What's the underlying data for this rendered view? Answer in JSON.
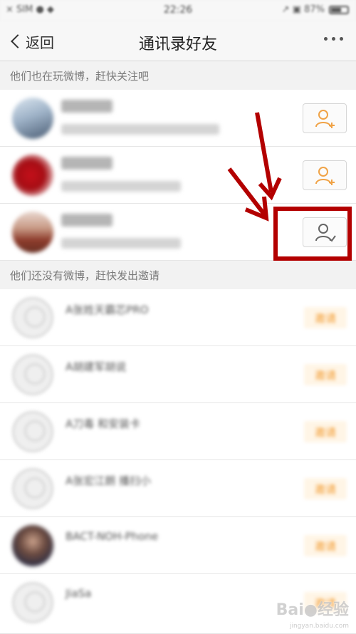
{
  "status_bar": {
    "left": "× SIM ● ◆",
    "time": "22:26",
    "right": "↗ ▣ 87%"
  },
  "nav": {
    "back_label": "返回",
    "title": "通讯录好友",
    "more_icon": "ellipsis-icon"
  },
  "sections": {
    "on_weibo_header": "他们也在玩微博，赶快关注吧",
    "not_on_weibo_header": "他们还没有微博，赶快发出邀请"
  },
  "invite_label": "邀请",
  "watermark": {
    "main": "Bai●经验",
    "sub": "jingyan.baidu.com"
  },
  "colors": {
    "accent_orange": "#f29a2e",
    "annotation_red": "#b30000",
    "follow_icon_orange": "#f0a347",
    "followed_icon_gray": "#666666"
  },
  "contacts_on_weibo": [
    {
      "status": "follow",
      "icon": "add-user-icon"
    },
    {
      "status": "follow",
      "icon": "add-user-icon"
    },
    {
      "status": "followed",
      "icon": "user-check-icon"
    }
  ],
  "contacts_invite": [
    {
      "name": "A张姓天霸芯PRO",
      "avatar": "placeholder"
    },
    {
      "name": "A胡建军胡说",
      "avatar": "placeholder"
    },
    {
      "name": "A刀毒 和安装卡",
      "avatar": "placeholder"
    },
    {
      "name": "A张宏江朗 播扫小",
      "avatar": "placeholder"
    },
    {
      "name": "BACT-NOH-Phone",
      "avatar": "photo"
    },
    {
      "name": "JiaSa",
      "avatar": "placeholder"
    }
  ]
}
